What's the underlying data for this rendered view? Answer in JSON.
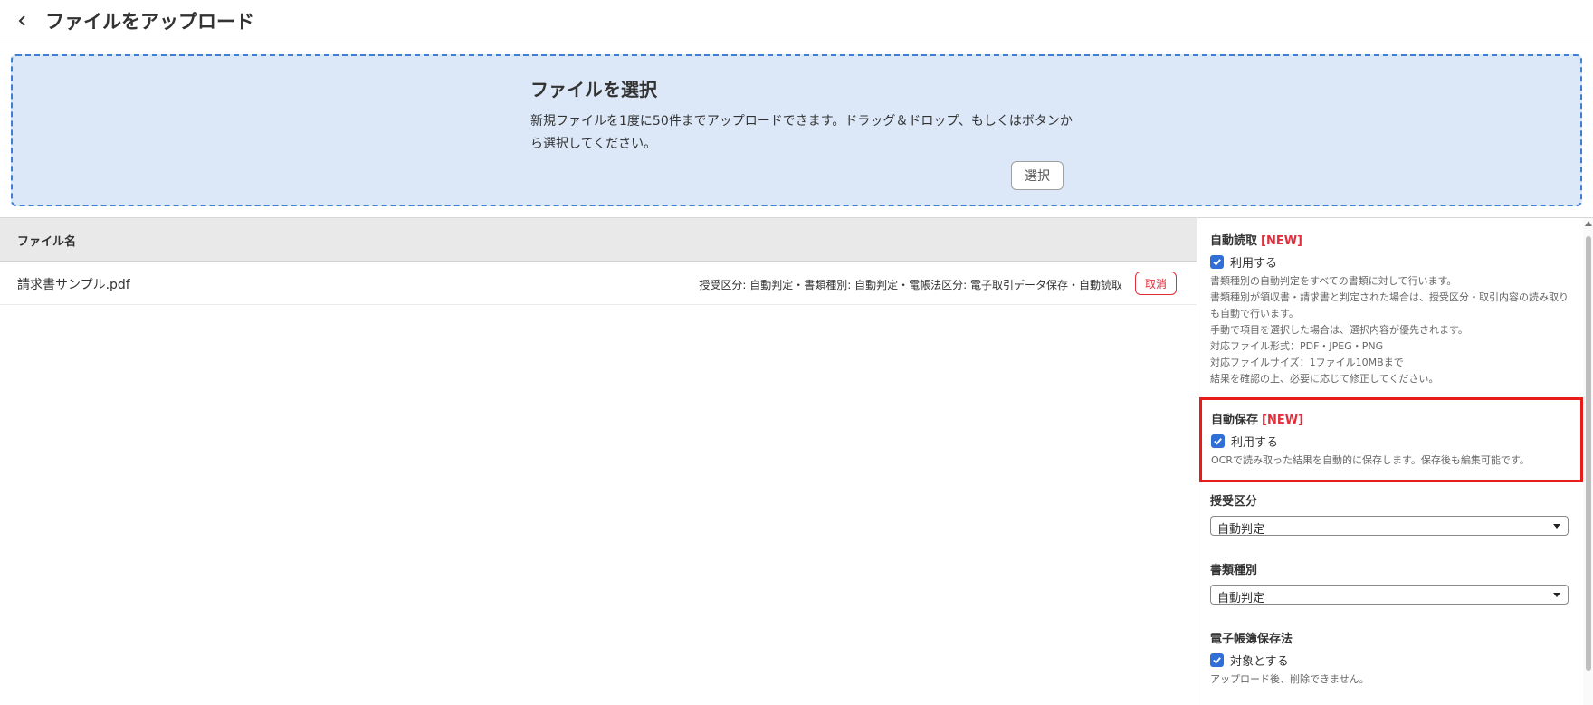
{
  "header": {
    "back_icon": "chevron-left-icon",
    "title": "ファイルをアップロード"
  },
  "dropzone": {
    "title": "ファイルを選択",
    "description": "新規ファイルを1度に50件までアップロードできます。ドラッグ＆ドロップ、もしくはボタンから選択してください。",
    "button_label": "選択"
  },
  "file_list": {
    "column_filename": "ファイル名",
    "rows": [
      {
        "name": "請求書サンプル.pdf",
        "meta": "授受区分: 自動判定・書類種別: 自動判定・電帳法区分: 電子取引データ保存・自動読取",
        "cancel_label": "取消"
      }
    ]
  },
  "side_panel": {
    "auto_read": {
      "title": "自動読取",
      "badge": "[NEW]",
      "checkbox_label": "利用する",
      "checked": true,
      "help_lines": [
        "書類種別の自動判定をすべての書類に対して行います。",
        "書類種別が領収書・請求書と判定された場合は、授受区分・取引内容の読み取りも自動で行います。",
        "手動で項目を選択した場合は、選択内容が優先されます。",
        "対応ファイル形式：PDF・JPEG・PNG",
        "対応ファイルサイズ：1ファイル10MBまで",
        "結果を確認の上、必要に応じて修正してください。"
      ]
    },
    "auto_save": {
      "title": "自動保存",
      "badge": "[NEW]",
      "checkbox_label": "利用する",
      "checked": true,
      "help": "OCRで読み取った結果を自動的に保存します。保存後も編集可能です。"
    },
    "category": {
      "title": "授受区分",
      "selected": "自動判定"
    },
    "doc_type": {
      "title": "書類種別",
      "selected": "自動判定"
    },
    "ebook_law": {
      "title": "電子帳簿保存法",
      "checkbox_label": "対象とする",
      "checked": true,
      "help": "アップロード後、削除できません。"
    }
  },
  "colors": {
    "accent": "#2f6fd6",
    "dropzone_bg": "#dce8f8",
    "dropzone_border": "#3e7fd1",
    "danger": "#e0303d",
    "highlight_box": "#e81b1b"
  }
}
